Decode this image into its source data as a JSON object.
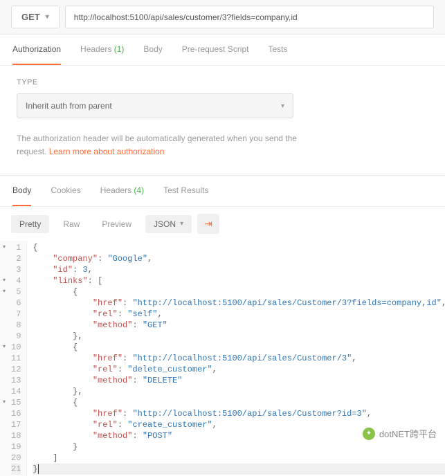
{
  "request": {
    "method": "GET",
    "url": "http://localhost:5100/api/sales/customer/3?fields=company,id"
  },
  "reqTabs": {
    "authorization": "Authorization",
    "headers": "Headers",
    "headersCount": "(1)",
    "body": "Body",
    "prerequest": "Pre-request Script",
    "tests": "Tests"
  },
  "auth": {
    "typeLabel": "TYPE",
    "selected": "Inherit auth from parent",
    "desc1": "The authorization header will be automatically generated when you send the request. ",
    "link": "Learn more about authorization"
  },
  "respTabs": {
    "body": "Body",
    "cookies": "Cookies",
    "headers": "Headers",
    "headersCount": "(4)",
    "testResults": "Test Results"
  },
  "toolbar": {
    "pretty": "Pretty",
    "raw": "Raw",
    "preview": "Preview",
    "format": "JSON"
  },
  "code": {
    "l1": "{",
    "l2": "    \"company\": \"Google\",",
    "l3": "    \"id\": 3,",
    "l4": "    \"links\": [",
    "l5": "        {",
    "l6": "            \"href\": \"http://localhost:5100/api/sales/Customer/3?fields=company,id\",",
    "l7": "            \"rel\": \"self\",",
    "l8": "            \"method\": \"GET\"",
    "l9": "        },",
    "l10": "        {",
    "l11": "            \"href\": \"http://localhost:5100/api/sales/Customer/3\",",
    "l12": "            \"rel\": \"delete_customer\",",
    "l13": "            \"method\": \"DELETE\"",
    "l14": "        },",
    "l15": "        {",
    "l16": "            \"href\": \"http://localhost:5100/api/sales/Customer?id=3\",",
    "l17": "            \"rel\": \"create_customer\",",
    "l18": "            \"method\": \"POST\"",
    "l19": "        }",
    "l20": "    ]",
    "l21": "}"
  },
  "watermark": "dotNET跨平台"
}
